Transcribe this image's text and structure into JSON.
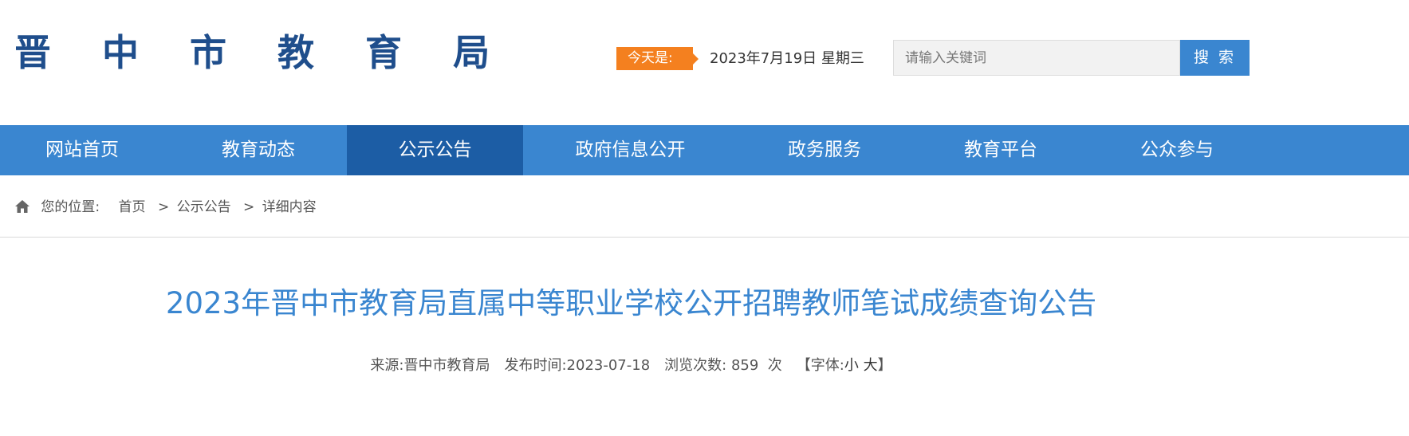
{
  "header": {
    "logo_text": "晋 中 市 教 育 局",
    "today_label": "今天是:",
    "date_text": "2023年7月19日 星期三",
    "search": {
      "placeholder": "请输入关键词",
      "button_label": "搜 索"
    }
  },
  "nav": {
    "items": [
      {
        "label": "网站首页"
      },
      {
        "label": "教育动态"
      },
      {
        "label": "公示公告",
        "active": true
      },
      {
        "label": "政府信息公开"
      },
      {
        "label": "政务服务"
      },
      {
        "label": "教育平台"
      },
      {
        "label": "公众参与"
      }
    ]
  },
  "breadcrumb": {
    "label": "您的位置:",
    "items": [
      "首页",
      "公示公告",
      "详细内容"
    ],
    "separator": ">"
  },
  "article": {
    "title": "2023年晋中市教育局直属中等职业学校公开招聘教师笔试成绩查询公告",
    "meta": {
      "source_label": "来源:",
      "source_value": "晋中市教育局",
      "publish_label": "发布时间:",
      "publish_value": "2023-07-18",
      "views_label": "浏览次数:",
      "views_value": "859",
      "views_unit": "次",
      "font_label": "【字体:",
      "font_small": "小",
      "font_large": "大",
      "font_close": "】"
    }
  },
  "colors": {
    "nav_bg": "#3a86d0",
    "nav_active_bg": "#1c5da5",
    "logo": "#1f4e8c",
    "title": "#3a86d0",
    "today_badge": "#f4801f"
  },
  "icons": {
    "home": "home-icon"
  }
}
